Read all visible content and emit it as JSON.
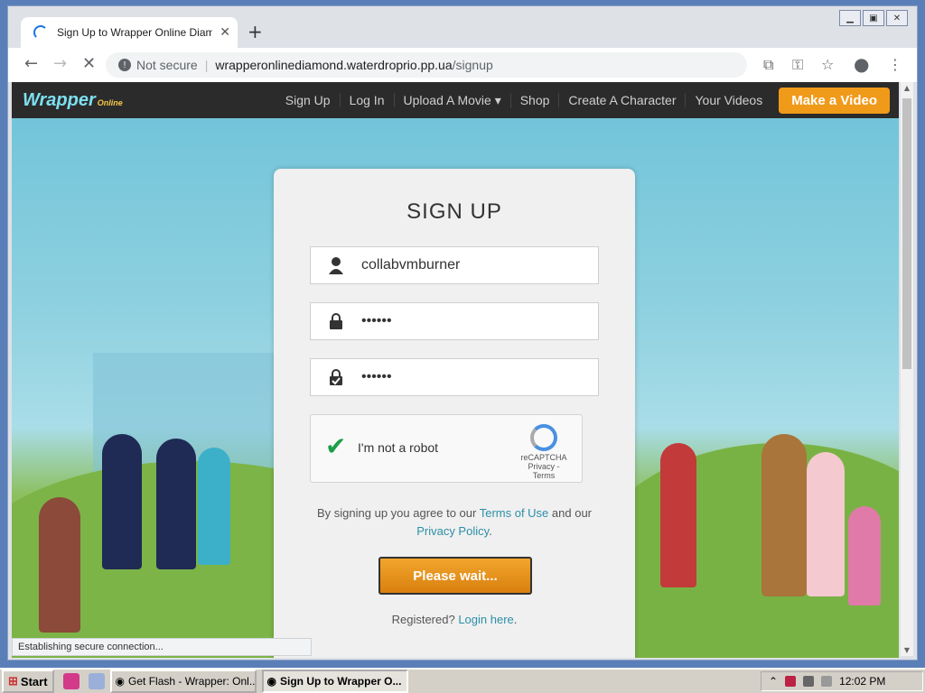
{
  "browser": {
    "tab_title": "Sign Up to Wrapper Online Diamond",
    "new_tab": "+",
    "not_secure": "Not secure",
    "url_host": "wrapperonlinediamond.waterdroprio.pp.ua",
    "url_path": "/signup",
    "status_text": "Establishing secure connection..."
  },
  "site": {
    "logo": "Wrapper",
    "logo_sub": "Online",
    "nav": [
      "Sign Up",
      "Log In",
      "Upload A Movie",
      "Shop",
      "Create A Character",
      "Your Videos"
    ],
    "cta": "Make a Video"
  },
  "form": {
    "title": "SIGN UP",
    "username": "collabvmburner",
    "password": "••••••",
    "confirm": "••••••",
    "captcha_label": "I'm not a robot",
    "captcha_brand": "reCAPTCHA",
    "captcha_links": "Privacy - Terms",
    "terms_pre": "By signing up you agree to our ",
    "terms_link": "Terms of Use",
    "terms_mid": " and our",
    "privacy_link": "Privacy Policy",
    "terms_post": ".",
    "submit": "Please wait...",
    "reg_pre": "Registered? ",
    "reg_link": "Login here",
    "reg_post": "."
  },
  "taskbar": {
    "start": "Start",
    "task1": "Get Flash - Wrapper: Onl...",
    "task2": "Sign Up to Wrapper O...",
    "clock": "12:02 PM"
  }
}
